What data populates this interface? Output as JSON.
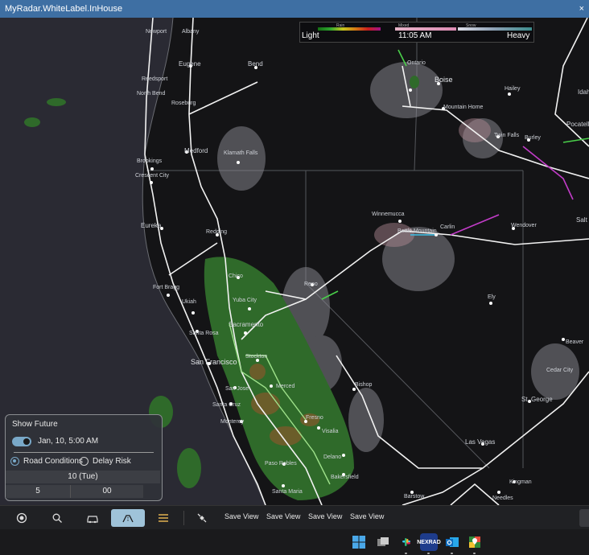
{
  "window": {
    "title": "MyRadar.WhiteLabel.InHouse",
    "close_glyph": "×"
  },
  "legend": {
    "light": "Light",
    "time": "11:05 AM",
    "heavy": "Heavy",
    "rain": "Rain",
    "mixed": "Mixed",
    "snow": "Snow"
  },
  "cities": [
    {
      "label": "Newport",
      "cls": ""
    },
    {
      "label": "Albany",
      "cls": ""
    },
    {
      "label": "Eugene",
      "cls": "mid"
    },
    {
      "label": "Bend",
      "cls": "mid"
    },
    {
      "label": "Ontario",
      "cls": ""
    },
    {
      "label": "Boise",
      "cls": "big"
    },
    {
      "label": "Hailey",
      "cls": ""
    },
    {
      "label": "Idaho",
      "cls": "mid"
    },
    {
      "label": "Reedsport",
      "cls": ""
    },
    {
      "label": "North Bend",
      "cls": ""
    },
    {
      "label": "Roseburg",
      "cls": ""
    },
    {
      "label": "Mountain Home",
      "cls": ""
    },
    {
      "label": "Pocatello",
      "cls": "mid"
    },
    {
      "label": "Twin Falls",
      "cls": ""
    },
    {
      "label": "Burley",
      "cls": ""
    },
    {
      "label": "Medford",
      "cls": "mid"
    },
    {
      "label": "Klamath Falls",
      "cls": ""
    },
    {
      "label": "Brookings",
      "cls": ""
    },
    {
      "label": "Crescent City",
      "cls": ""
    },
    {
      "label": "Winnemucca",
      "cls": ""
    },
    {
      "label": "Battle Mountain",
      "cls": ""
    },
    {
      "label": "Carlin",
      "cls": ""
    },
    {
      "label": "Wendover",
      "cls": ""
    },
    {
      "label": "Salt",
      "cls": "mid"
    },
    {
      "label": "Eureka",
      "cls": "mid"
    },
    {
      "label": "Redding",
      "cls": ""
    },
    {
      "label": "Chico",
      "cls": ""
    },
    {
      "label": "Reno",
      "cls": ""
    },
    {
      "label": "Fort Bragg",
      "cls": ""
    },
    {
      "label": "Ukiah",
      "cls": ""
    },
    {
      "label": "Yuba City",
      "cls": ""
    },
    {
      "label": "Ely",
      "cls": ""
    },
    {
      "label": "Sacramento",
      "cls": "mid"
    },
    {
      "label": "Santa Rosa",
      "cls": ""
    },
    {
      "label": "Stockton",
      "cls": ""
    },
    {
      "label": "San Francisco",
      "cls": "big"
    },
    {
      "label": "Beaver",
      "cls": ""
    },
    {
      "label": "Cedar City",
      "cls": ""
    },
    {
      "label": "San Jose",
      "cls": ""
    },
    {
      "label": "Merced",
      "cls": ""
    },
    {
      "label": "Bishop",
      "cls": ""
    },
    {
      "label": "Santa Cruz",
      "cls": ""
    },
    {
      "label": "Monterey",
      "cls": ""
    },
    {
      "label": "Fresno",
      "cls": ""
    },
    {
      "label": "Visalia",
      "cls": ""
    },
    {
      "label": "St. George",
      "cls": "mid"
    },
    {
      "label": "Las Vegas",
      "cls": "mid"
    },
    {
      "label": "Delano",
      "cls": ""
    },
    {
      "label": "Paso Robles",
      "cls": ""
    },
    {
      "label": "Bakersfield",
      "cls": ""
    },
    {
      "label": "Santa Maria",
      "cls": ""
    },
    {
      "label": "Kingman",
      "cls": ""
    },
    {
      "label": "Barstow",
      "cls": ""
    },
    {
      "label": "Needles",
      "cls": ""
    }
  ],
  "future": {
    "title": "Show Future",
    "datetime": "Jan, 10, 5:00 AM",
    "opt1": "Road Conditions",
    "opt2": "Delay Risk",
    "day": "10 (Tue)",
    "hour": "5",
    "minute": "00"
  },
  "toolbar": {
    "save1": "Save View",
    "save2": "Save View",
    "save3": "Save View",
    "save4": "Save View"
  },
  "taskbar": {
    "apps": [
      "start",
      "widgets",
      "slack",
      "myradar",
      "outlook",
      "maps"
    ],
    "myradar_text": "NEXRAD"
  }
}
